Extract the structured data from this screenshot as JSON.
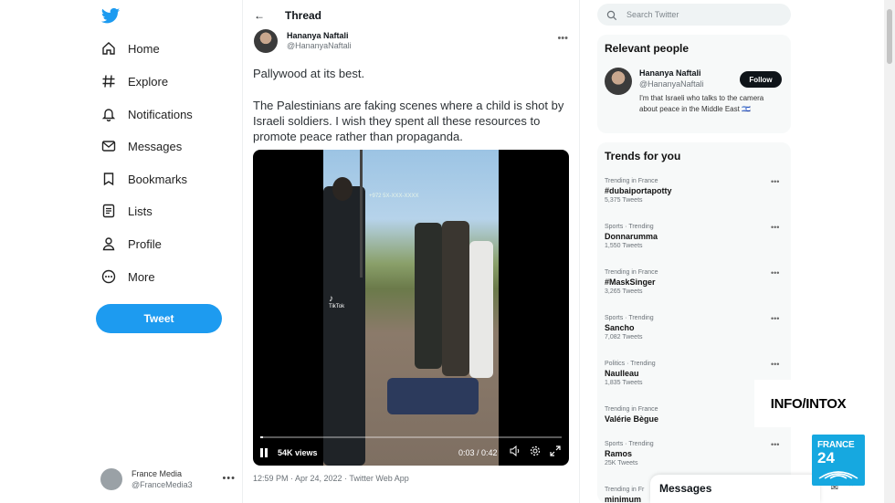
{
  "colors": {
    "accent": "#1d9bf0",
    "brand": "#16a8e0"
  },
  "nav": {
    "logo_icon": "twitter-bird-icon",
    "items": [
      {
        "label": "Home",
        "icon": "home-icon"
      },
      {
        "label": "Explore",
        "icon": "hashtag-icon"
      },
      {
        "label": "Notifications",
        "icon": "bell-icon"
      },
      {
        "label": "Messages",
        "icon": "envelope-icon"
      },
      {
        "label": "Bookmarks",
        "icon": "bookmark-icon"
      },
      {
        "label": "Lists",
        "icon": "list-icon"
      },
      {
        "label": "Profile",
        "icon": "person-icon"
      },
      {
        "label": "More",
        "icon": "more-circle-icon"
      }
    ],
    "tweet_button": "Tweet",
    "account": {
      "name": "France Media",
      "handle": "@FranceMedia3"
    }
  },
  "thread": {
    "title": "Thread",
    "author": {
      "name": "Hananya Naftali",
      "handle": "@HananyaNaftali"
    },
    "text1": "Pallywood at its best.",
    "text2": "The Palestinians are faking scenes where a child is shot by Israeli soldiers. I wish they spent all these resources to promote peace rather than propaganda.",
    "video": {
      "views": "54K views",
      "time": "0:03 / 0:42",
      "tiktok_label": "TikTok",
      "watermark": "+972 5X-XXX-XXXX"
    },
    "meta": "12:59 PM · Apr 24, 2022 · Twitter Web App"
  },
  "search": {
    "placeholder": "Search Twitter"
  },
  "relevant": {
    "title": "Relevant people",
    "person": {
      "name": "Hananya Naftali",
      "handle": "@HananyaNaftali",
      "bio": "I'm that Israeli who talks to the camera about peace in the Middle East 🇮🇱",
      "follow_label": "Follow"
    }
  },
  "trends": {
    "title": "Trends for you",
    "items": [
      {
        "context": "Trending in France",
        "name": "#dubaiportapotty",
        "count": "5,375 Tweets"
      },
      {
        "context": "Sports · Trending",
        "name": "Donnarumma",
        "count": "1,550 Tweets"
      },
      {
        "context": "Trending in France",
        "name": "#MaskSinger",
        "count": "3,265 Tweets"
      },
      {
        "context": "Sports · Trending",
        "name": "Sancho",
        "count": "7,082 Tweets"
      },
      {
        "context": "Politics · Trending",
        "name": "Naulleau",
        "count": "1,835 Tweets"
      },
      {
        "context": "Trending in France",
        "name": "Valérie Bègue",
        "count": ""
      },
      {
        "context": "Sports · Trending",
        "name": "Ramos",
        "count": "25K Tweets"
      },
      {
        "context": "Trending in Fr",
        "name": "minimum",
        "count": ""
      }
    ]
  },
  "messages_bar": {
    "title": "Messages"
  },
  "overlay": {
    "show_logo": "INFO/INTOX",
    "channel_line1": "FRANCE",
    "channel_line2": "24"
  }
}
